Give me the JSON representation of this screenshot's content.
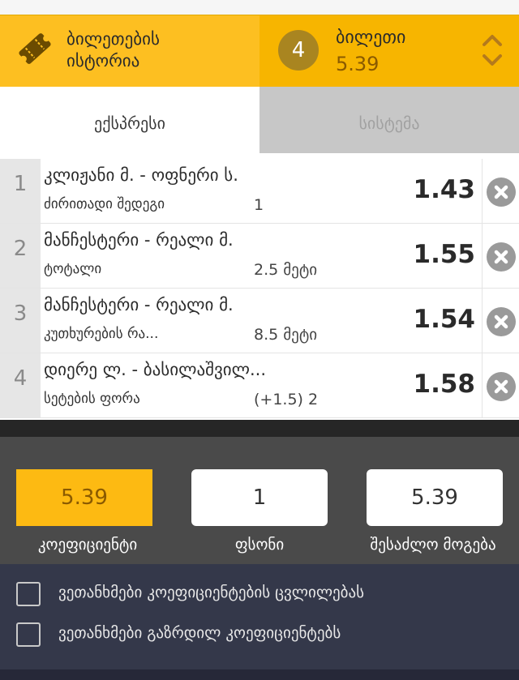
{
  "header": {
    "history_label": "ბილეთების ისტორია",
    "slip_count": "4",
    "slip_title": "ბილეთი",
    "slip_total": "5.39"
  },
  "tabs": {
    "express": "ექსპრესი",
    "system": "სისტემა"
  },
  "bets": [
    {
      "index": "1",
      "event": "კლიჟანი მ. - ოფნერი ს.",
      "market": "ძირითადი შედეგი",
      "pick": "1",
      "odd": "1.43"
    },
    {
      "index": "2",
      "event": "მანჩესტერი - რეალი მ.",
      "market": "ტოტალი",
      "pick": "2.5 მეტი",
      "odd": "1.55"
    },
    {
      "index": "3",
      "event": "მანჩესტერი - რეალი მ.",
      "market": "კუთხურების რა...",
      "pick": "8.5 მეტი",
      "odd": "1.54"
    },
    {
      "index": "4",
      "event": "დიერე ლ. - ბასილაშვილ...",
      "market": "სეტების ფორა",
      "pick": "(+1.5) 2",
      "odd": "1.58"
    }
  ],
  "stake_panel": {
    "coefficient_value": "5.39",
    "coefficient_label": "კოეფიციენტი",
    "stake_value": "1",
    "stake_label": "ფსონი",
    "possible_win_value": "5.39",
    "possible_win_label": "შესაძლო მოგება"
  },
  "agreements": {
    "accept_changes": "ვეთანხმები კოეფიციენტების ცვლილებას",
    "accept_increased": "ვეთანხმები გაზრდილ კოეფიციენტებს"
  },
  "colors": {
    "accent": "#fdbf21",
    "accent_dark": "#f7b500",
    "panel_dark": "#4a4a4a",
    "agree_bg": "#34384a"
  },
  "icons": {
    "history": "ticket-icon",
    "expand": "chevron-up-down-icon",
    "remove": "close-circle-icon"
  }
}
